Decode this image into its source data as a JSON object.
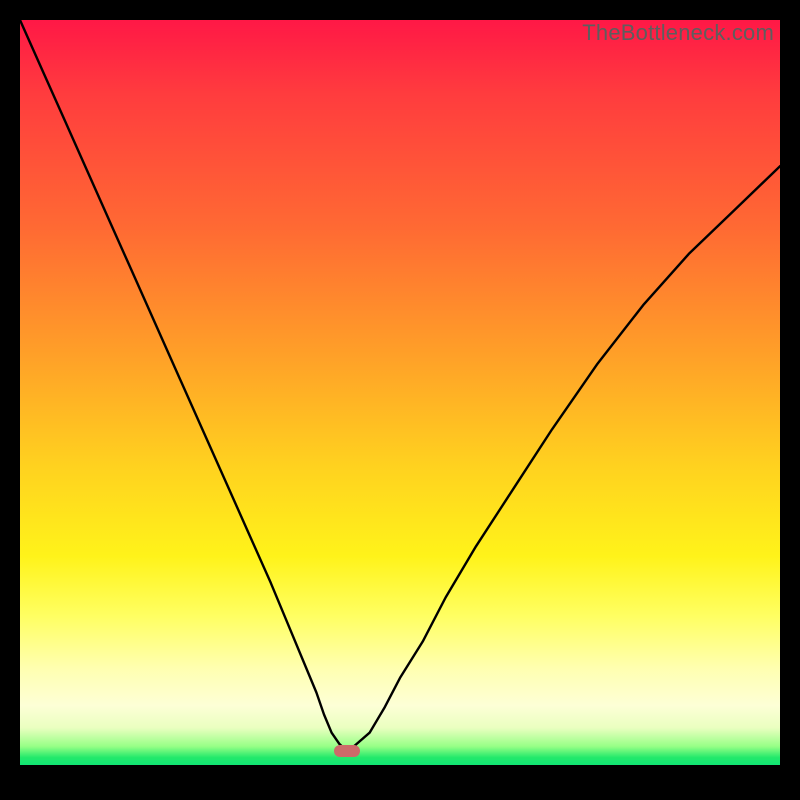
{
  "watermark": "TheBottleneck.com",
  "colors": {
    "frame": "#000000",
    "gradient_top": "#ff1846",
    "gradient_mid": "#ffd21f",
    "gradient_bottom": "#11e574",
    "curve": "#000000",
    "marker": "#cc6a69"
  },
  "chart_data": {
    "type": "line",
    "title": "",
    "xlabel": "",
    "ylabel": "",
    "xlim": [
      0,
      100
    ],
    "ylim": [
      0,
      100
    ],
    "x": [
      0,
      3,
      6,
      9,
      12,
      15,
      18,
      21,
      24,
      27,
      30,
      33,
      35,
      37,
      39,
      40,
      41,
      42,
      43,
      44,
      46,
      48,
      50,
      53,
      56,
      60,
      65,
      70,
      76,
      82,
      88,
      94,
      100
    ],
    "values": [
      100,
      93,
      86,
      79,
      72,
      65,
      58,
      51,
      44,
      37,
      30,
      23,
      18,
      13,
      8,
      5,
      2.5,
      1,
      0,
      0.7,
      2.5,
      6,
      10,
      15,
      21,
      28,
      36,
      44,
      53,
      61,
      68,
      74,
      80
    ],
    "minimum": {
      "x": 43,
      "y": 0
    },
    "annotations": [
      {
        "type": "marker",
        "x": 43,
        "y": 0,
        "shape": "pill",
        "color": "#cc6a69"
      }
    ]
  }
}
